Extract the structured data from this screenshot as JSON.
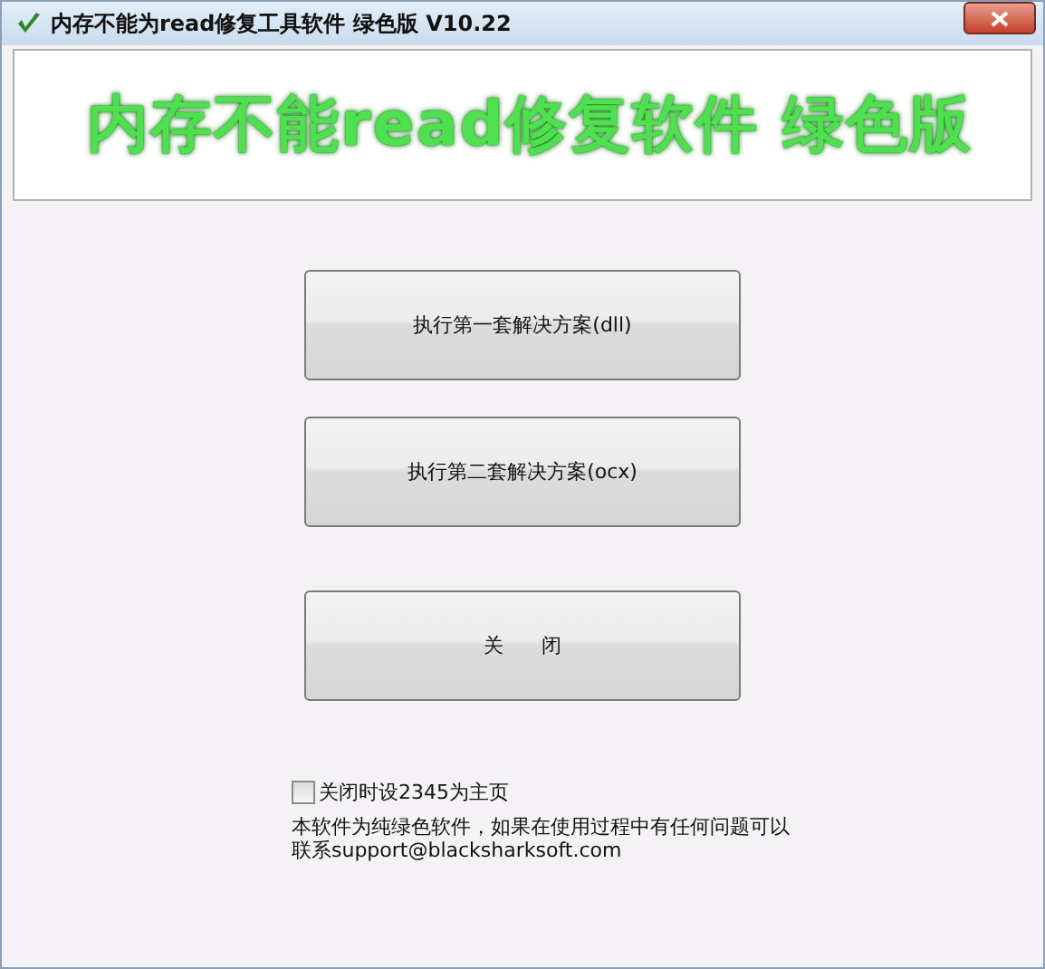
{
  "window": {
    "title": "内存不能为read修复工具软件 绿色版 V10.22"
  },
  "banner": {
    "text": "内存不能read修复软件 绿色版"
  },
  "buttons": [
    {
      "label": "执行第一套解决方案(dll)"
    },
    {
      "label": "执行第二套解决方案(ocx)"
    },
    {
      "label": "关      闭"
    }
  ],
  "checkbox": {
    "label": "关闭时设2345为主页",
    "checked": false
  },
  "notice": [
    "本软件为纯绿色软件，如果在使用过程中有任何问题可以",
    "联系support@blacksharksoft.com"
  ]
}
